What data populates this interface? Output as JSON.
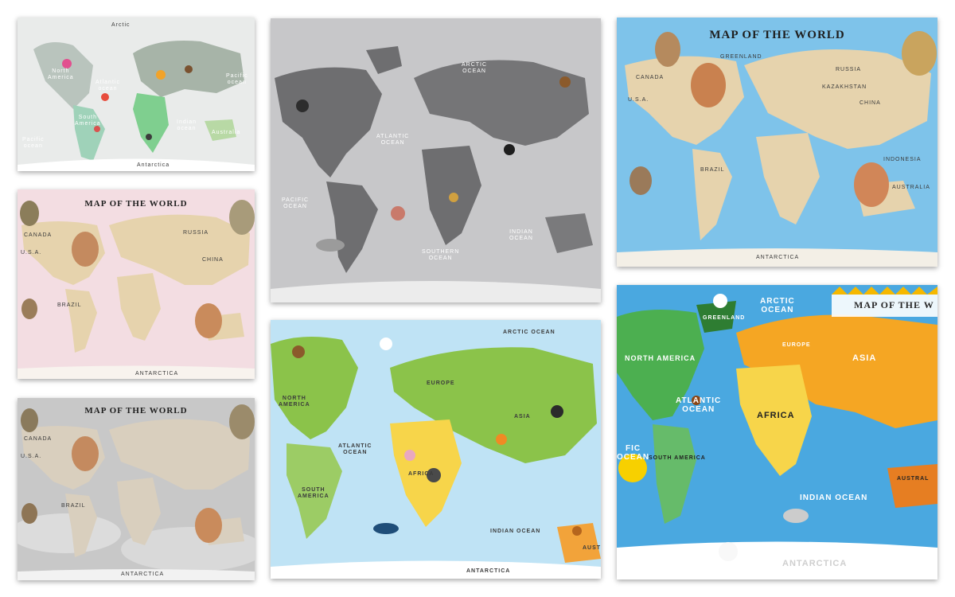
{
  "tiles": {
    "pastel": {
      "labels": {
        "north_america": "North\nAmerica",
        "atlantic": "Atlantic\nocean",
        "south_america": "South\nAmerica",
        "indian": "Indian\nocean",
        "pacific_right": "Pacific\nocean",
        "pacific_left": "Pacific\nocean",
        "australia": "Australia",
        "antarctica": "Antarctica",
        "arctic": "Arctic"
      }
    },
    "grey_large": {
      "labels": {
        "arctic": "ARCTIC\nOCEAN",
        "atlantic": "ATLANTIC\nOCEAN",
        "pacific": "PACIFIC\nOCEAN",
        "indian": "INDIAN\nOCEAN",
        "southern": "SOUTHERN\nOCEAN"
      }
    },
    "blue_world": {
      "title": "MAP OF THE WORLD",
      "labels": {
        "greenland": "GREENLAND",
        "russia": "RUSSIA",
        "canada": "CANADA",
        "usa": "U.S.A.",
        "brazil": "BRAZIL",
        "australia": "AUSTRALIA",
        "antarctica": "ANTARCTICA",
        "kazakhstan": "KAZAKHSTAN",
        "china": "CHINA",
        "indonesia": "INDONESIA"
      }
    },
    "pink_world": {
      "title": "MAP OF THE WORLD",
      "labels": {
        "russia": "RUSSIA",
        "canada": "CANADA",
        "usa": "U.S.A.",
        "brazil": "BRAZIL",
        "china": "CHINA",
        "antarctica": "ANTARCTICA"
      }
    },
    "grey_world": {
      "title": "MAP OF THE WORLD",
      "labels": {
        "canada": "CANADA",
        "usa": "U.S.A.",
        "brazil": "BRAZIL",
        "antarctica": "ANTARCTICA"
      }
    },
    "cartoon_green": {
      "labels": {
        "arctic": "ARCTIC OCEAN",
        "europe": "EUROPE",
        "north_america": "NORTH\nAMERICA",
        "asia": "ASIA",
        "atlantic": "ATLANTIC\nOCEAN",
        "africa": "AFRICA",
        "south_america": "SOUTH\nAMERICA",
        "indian": "INDIAN OCEAN",
        "antarctica": "ANTARCTICA",
        "australia": "AUST"
      }
    },
    "cartoon_bright": {
      "title": "MAP OF THE W",
      "labels": {
        "arctic": "ARCTIC\nOCEAN",
        "greenland": "GREENLAND",
        "europe": "EUROPE",
        "north_america": "NORTH AMERICA",
        "asia": "ASIA",
        "atlantic": "ATLANTIC\nOCEAN",
        "africa": "AFRICA",
        "south_america": "SOUTH AMERICA",
        "pacific": "FIC\nOCEAN",
        "indian": "INDIAN OCEAN",
        "australia": "AUSTRAL",
        "antarctica": "ANTARCTICA"
      }
    }
  },
  "colors": {
    "grey_bg": "#c7c7c9",
    "grey_land": "#6e6e70",
    "blue_sea": "#7ec3ea",
    "beige_land": "#e6d3ad",
    "pink_sea": "#f3dde2",
    "light_blue_sea": "#bfe3f5",
    "green_land": "#8bc34a",
    "yellow_africa": "#f7d54a",
    "bright_sea": "#4aa8e0"
  }
}
